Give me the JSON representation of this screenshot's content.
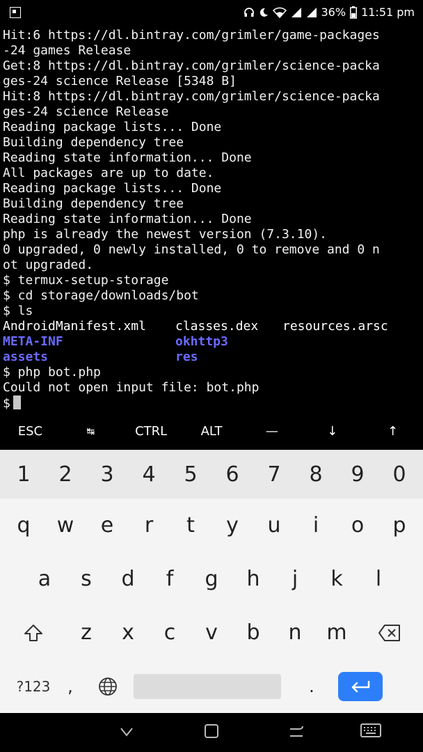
{
  "status_bar": {
    "battery_pct": "36%",
    "time": "11:51 pm",
    "icons": [
      "notification-icon",
      "headphones-icon",
      "moon-icon",
      "wifi-icon",
      "signal-icon",
      "signal-icon",
      "battery-icon"
    ]
  },
  "terminal": {
    "lines": [
      "Hit:6 https://dl.bintray.com/grimler/game-packages",
      "-24 games Release",
      "Get:8 https://dl.bintray.com/grimler/science-packa",
      "ges-24 science Release [5348 B]",
      "Hit:8 https://dl.bintray.com/grimler/science-packa",
      "ges-24 science Release",
      "Reading package lists... Done",
      "Building dependency tree",
      "Reading state information... Done",
      "All packages are up to date.",
      "Reading package lists... Done",
      "Building dependency tree",
      "Reading state information... Done",
      "php is already the newest version (7.3.10).",
      "0 upgraded, 0 newly installed, 0 to remove and 0 n",
      "ot upgraded.",
      "$ termux-setup-storage",
      "$ cd storage/downloads/bot",
      "$ ls"
    ],
    "ls_output": [
      [
        "AndroidManifest.xml",
        "classes.dex",
        "resources.arsc"
      ],
      [
        "META-INF",
        "okhttp3",
        ""
      ],
      [
        "assets",
        "res",
        ""
      ]
    ],
    "after_lines": [
      "$ php bot.php",
      "Could not open input file: bot.php"
    ],
    "prompt": "$"
  },
  "extra_keys": [
    "ESC",
    "↹",
    "CTRL",
    "ALT",
    "—",
    "↓",
    "↑"
  ],
  "keyboard": {
    "numbers": [
      "1",
      "2",
      "3",
      "4",
      "5",
      "6",
      "7",
      "8",
      "9",
      "0"
    ],
    "row1": [
      "q",
      "w",
      "e",
      "r",
      "t",
      "y",
      "u",
      "i",
      "o",
      "p"
    ],
    "row2": [
      "a",
      "s",
      "d",
      "f",
      "g",
      "h",
      "j",
      "k",
      "l"
    ],
    "row3": [
      "z",
      "x",
      "c",
      "v",
      "b",
      "n",
      "m"
    ],
    "symbols_label": "?123",
    "comma": ",",
    "period": ".",
    "enter_color": "#2d7ff9"
  }
}
